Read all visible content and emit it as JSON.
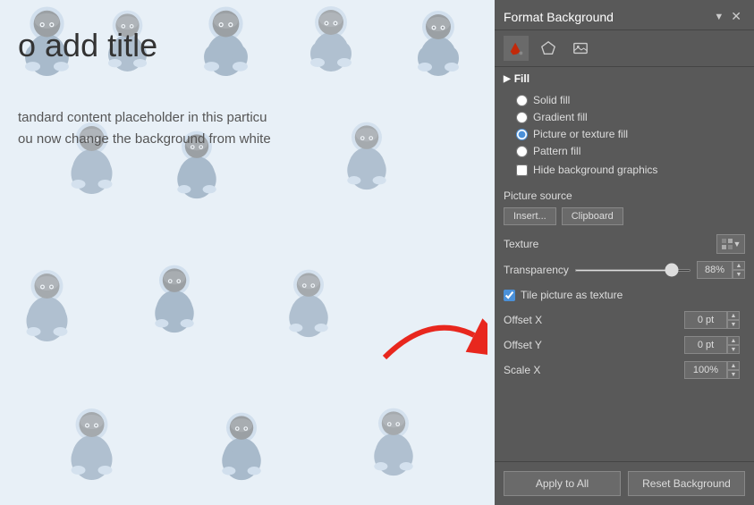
{
  "slide": {
    "title": "o add title",
    "body_line1": "tandard content placeholder in this particu",
    "body_line2": "ou now change the background from white"
  },
  "panel": {
    "title": "Format Background",
    "close_label": "✕",
    "icons": [
      {
        "name": "paint-bucket-icon",
        "symbol": "🪣",
        "active": true
      },
      {
        "name": "pentagon-icon",
        "symbol": "⬠",
        "active": false
      },
      {
        "name": "image-icon",
        "symbol": "🖼",
        "active": false
      }
    ],
    "section_fill": {
      "label": "Fill",
      "options": [
        {
          "id": "solid-fill",
          "label": "Solid fill",
          "selected": false
        },
        {
          "id": "gradient-fill",
          "label": "Gradient fill",
          "selected": false
        },
        {
          "id": "picture-texture-fill",
          "label": "Picture or texture fill",
          "selected": true
        },
        {
          "id": "pattern-fill",
          "label": "Pattern fill",
          "selected": false
        }
      ],
      "hide_bg_graphics_label": "Hide background graphics",
      "hide_bg_graphics_checked": false
    },
    "picture_source_label": "Picture source",
    "insert_button_label": "Insert...",
    "clipboard_button_label": "Clipboard",
    "texture_label": "Texture",
    "transparency_label": "Transparency",
    "transparency_value": "88%",
    "tile_picture_label": "Tile picture as texture",
    "tile_picture_checked": true,
    "offset_x_label": "Offset X",
    "offset_x_value": "0 pt",
    "offset_y_label": "Offset Y",
    "offset_y_value": "0 pt",
    "scale_x_label": "Scale X",
    "scale_x_value": "100%",
    "apply_all_label": "Apply to All",
    "reset_bg_label": "Reset Background"
  }
}
